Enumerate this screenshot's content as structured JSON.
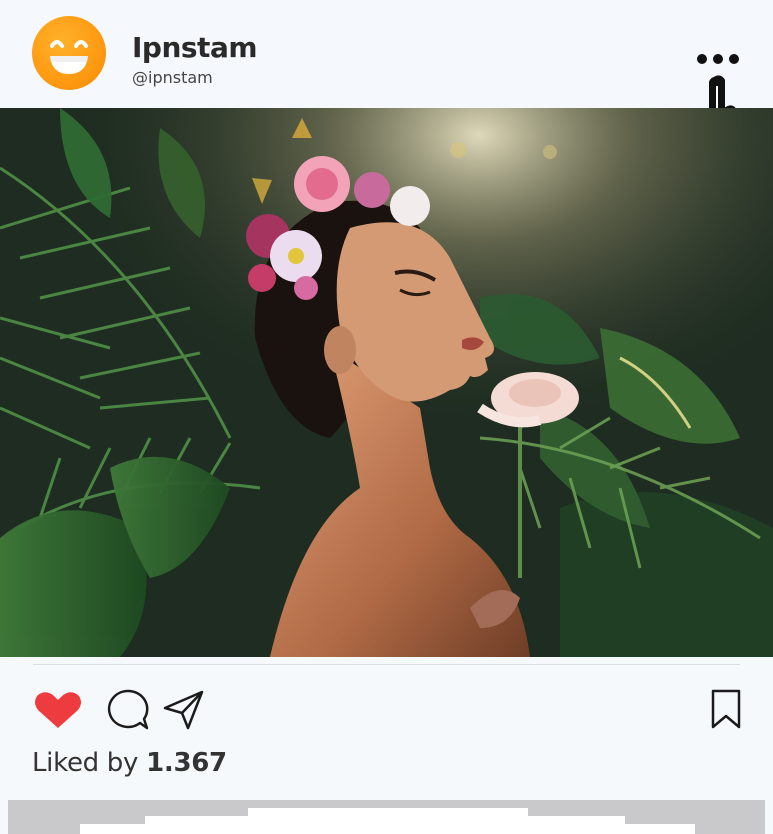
{
  "post": {
    "username": "Ipnstam",
    "handle": "@ipnstam",
    "likes_prefix": "Liked by",
    "likes_count": "1.367"
  },
  "icons": {
    "avatar": "grinning-face-icon",
    "more": "more-options-icon",
    "cursor": "hand-pointer-icon",
    "like": "heart-icon",
    "comment": "comment-icon",
    "share": "paper-plane-icon",
    "save": "bookmark-icon"
  },
  "colors": {
    "accent_like": "#ee3b3f",
    "avatar": "#ff9f14",
    "background": "#f5f9fd"
  }
}
